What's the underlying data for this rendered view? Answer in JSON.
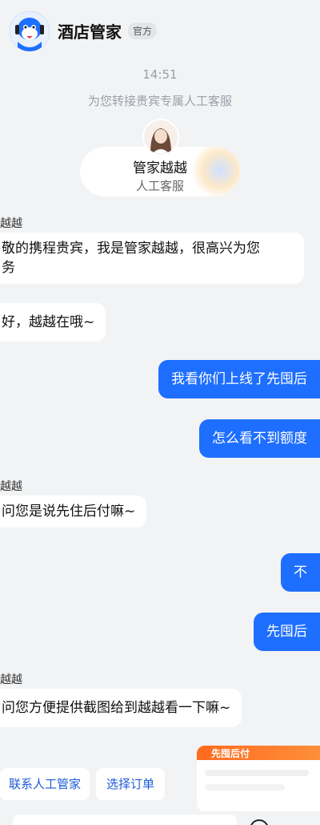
{
  "header": {
    "title": "酒店管家",
    "badge": "官方"
  },
  "chat": {
    "timestamp": "14:51",
    "transfer_note": "为您转接贵宾专属人工客服",
    "agent": {
      "name": "管家越越",
      "role": "人工客服"
    },
    "messages": [
      {
        "side": "left",
        "sender": "越越",
        "lines": [
          "敬的携程贵宾，我是管家越越，很高兴为您",
          "务"
        ]
      },
      {
        "side": "left",
        "text": "好，越越在哦~"
      },
      {
        "side": "right",
        "text": "我看你们上线了先囤后"
      },
      {
        "side": "right",
        "text": "怎么看不到额度"
      },
      {
        "side": "left",
        "sender": "越越",
        "text": "问您是说先住后付嘛~"
      },
      {
        "side": "right",
        "text": "不"
      },
      {
        "side": "right",
        "text": "先囤后"
      },
      {
        "side": "left",
        "sender": "越越",
        "text": "问您方便提供截图给到越越看一下嘛~"
      }
    ],
    "preview_card_label": "先囤后付"
  },
  "quick_actions": [
    {
      "label": "联系人工管家"
    },
    {
      "label": "选择订单"
    }
  ],
  "icons": {
    "logo": "mascot-avatar-icon",
    "emoji": "emoji-icon",
    "more": "more-icon"
  },
  "colors": {
    "accent": "#1e6fff",
    "background": "#f2f3f5",
    "link": "#1e5bd8"
  }
}
